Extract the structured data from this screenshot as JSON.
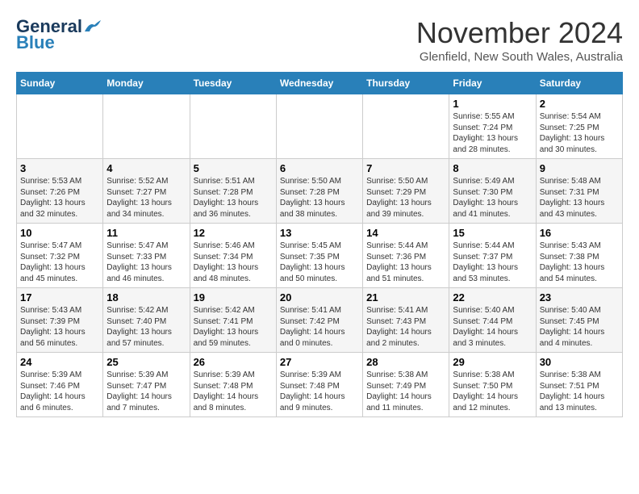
{
  "header": {
    "logo": {
      "general": "General",
      "blue": "Blue"
    },
    "title": "November 2024",
    "location": "Glenfield, New South Wales, Australia"
  },
  "weekdays": [
    "Sunday",
    "Monday",
    "Tuesday",
    "Wednesday",
    "Thursday",
    "Friday",
    "Saturday"
  ],
  "weeks": [
    [
      {
        "day": "",
        "info": ""
      },
      {
        "day": "",
        "info": ""
      },
      {
        "day": "",
        "info": ""
      },
      {
        "day": "",
        "info": ""
      },
      {
        "day": "",
        "info": ""
      },
      {
        "day": "1",
        "info": "Sunrise: 5:55 AM\nSunset: 7:24 PM\nDaylight: 13 hours\nand 28 minutes."
      },
      {
        "day": "2",
        "info": "Sunrise: 5:54 AM\nSunset: 7:25 PM\nDaylight: 13 hours\nand 30 minutes."
      }
    ],
    [
      {
        "day": "3",
        "info": "Sunrise: 5:53 AM\nSunset: 7:26 PM\nDaylight: 13 hours\nand 32 minutes."
      },
      {
        "day": "4",
        "info": "Sunrise: 5:52 AM\nSunset: 7:27 PM\nDaylight: 13 hours\nand 34 minutes."
      },
      {
        "day": "5",
        "info": "Sunrise: 5:51 AM\nSunset: 7:28 PM\nDaylight: 13 hours\nand 36 minutes."
      },
      {
        "day": "6",
        "info": "Sunrise: 5:50 AM\nSunset: 7:28 PM\nDaylight: 13 hours\nand 38 minutes."
      },
      {
        "day": "7",
        "info": "Sunrise: 5:50 AM\nSunset: 7:29 PM\nDaylight: 13 hours\nand 39 minutes."
      },
      {
        "day": "8",
        "info": "Sunrise: 5:49 AM\nSunset: 7:30 PM\nDaylight: 13 hours\nand 41 minutes."
      },
      {
        "day": "9",
        "info": "Sunrise: 5:48 AM\nSunset: 7:31 PM\nDaylight: 13 hours\nand 43 minutes."
      }
    ],
    [
      {
        "day": "10",
        "info": "Sunrise: 5:47 AM\nSunset: 7:32 PM\nDaylight: 13 hours\nand 45 minutes."
      },
      {
        "day": "11",
        "info": "Sunrise: 5:47 AM\nSunset: 7:33 PM\nDaylight: 13 hours\nand 46 minutes."
      },
      {
        "day": "12",
        "info": "Sunrise: 5:46 AM\nSunset: 7:34 PM\nDaylight: 13 hours\nand 48 minutes."
      },
      {
        "day": "13",
        "info": "Sunrise: 5:45 AM\nSunset: 7:35 PM\nDaylight: 13 hours\nand 50 minutes."
      },
      {
        "day": "14",
        "info": "Sunrise: 5:44 AM\nSunset: 7:36 PM\nDaylight: 13 hours\nand 51 minutes."
      },
      {
        "day": "15",
        "info": "Sunrise: 5:44 AM\nSunset: 7:37 PM\nDaylight: 13 hours\nand 53 minutes."
      },
      {
        "day": "16",
        "info": "Sunrise: 5:43 AM\nSunset: 7:38 PM\nDaylight: 13 hours\nand 54 minutes."
      }
    ],
    [
      {
        "day": "17",
        "info": "Sunrise: 5:43 AM\nSunset: 7:39 PM\nDaylight: 13 hours\nand 56 minutes."
      },
      {
        "day": "18",
        "info": "Sunrise: 5:42 AM\nSunset: 7:40 PM\nDaylight: 13 hours\nand 57 minutes."
      },
      {
        "day": "19",
        "info": "Sunrise: 5:42 AM\nSunset: 7:41 PM\nDaylight: 13 hours\nand 59 minutes."
      },
      {
        "day": "20",
        "info": "Sunrise: 5:41 AM\nSunset: 7:42 PM\nDaylight: 14 hours\nand 0 minutes."
      },
      {
        "day": "21",
        "info": "Sunrise: 5:41 AM\nSunset: 7:43 PM\nDaylight: 14 hours\nand 2 minutes."
      },
      {
        "day": "22",
        "info": "Sunrise: 5:40 AM\nSunset: 7:44 PM\nDaylight: 14 hours\nand 3 minutes."
      },
      {
        "day": "23",
        "info": "Sunrise: 5:40 AM\nSunset: 7:45 PM\nDaylight: 14 hours\nand 4 minutes."
      }
    ],
    [
      {
        "day": "24",
        "info": "Sunrise: 5:39 AM\nSunset: 7:46 PM\nDaylight: 14 hours\nand 6 minutes."
      },
      {
        "day": "25",
        "info": "Sunrise: 5:39 AM\nSunset: 7:47 PM\nDaylight: 14 hours\nand 7 minutes."
      },
      {
        "day": "26",
        "info": "Sunrise: 5:39 AM\nSunset: 7:48 PM\nDaylight: 14 hours\nand 8 minutes."
      },
      {
        "day": "27",
        "info": "Sunrise: 5:39 AM\nSunset: 7:48 PM\nDaylight: 14 hours\nand 9 minutes."
      },
      {
        "day": "28",
        "info": "Sunrise: 5:38 AM\nSunset: 7:49 PM\nDaylight: 14 hours\nand 11 minutes."
      },
      {
        "day": "29",
        "info": "Sunrise: 5:38 AM\nSunset: 7:50 PM\nDaylight: 14 hours\nand 12 minutes."
      },
      {
        "day": "30",
        "info": "Sunrise: 5:38 AM\nSunset: 7:51 PM\nDaylight: 14 hours\nand 13 minutes."
      }
    ]
  ]
}
